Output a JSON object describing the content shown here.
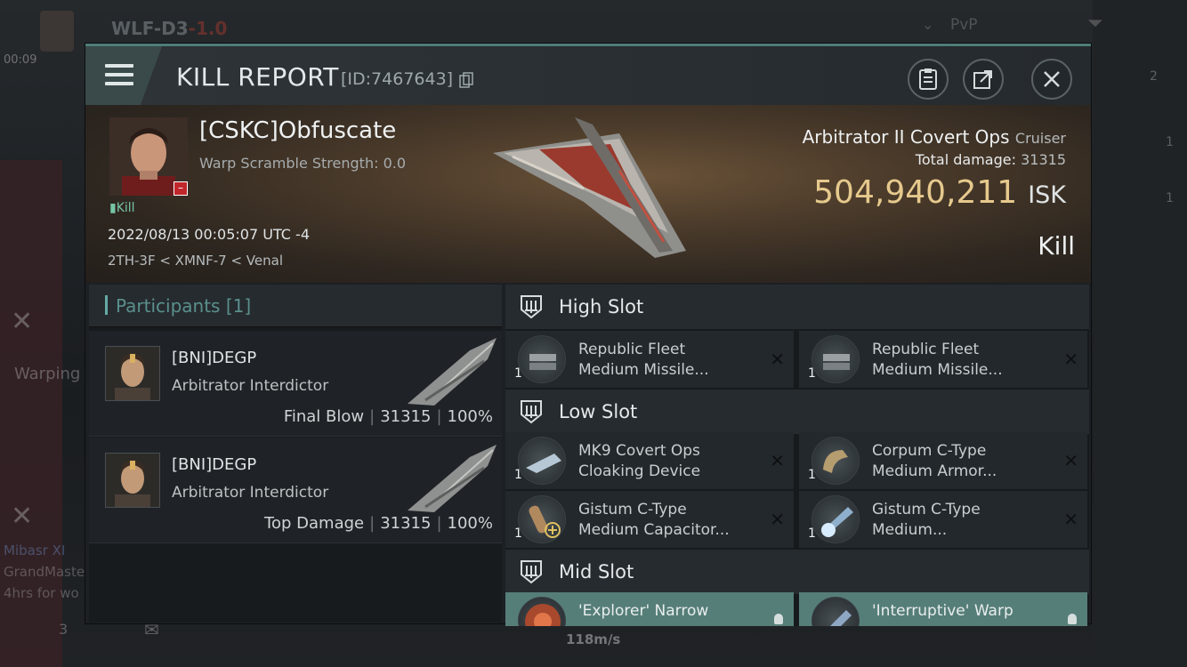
{
  "background": {
    "system_name": "WLF-D3",
    "security": "-1.0",
    "pvp_label": "PvP",
    "timer": "00:09",
    "warping_label": "Warping",
    "chat_name": "Mibasr XI",
    "chat_line": "GrandMaste",
    "chat_time": "4hrs for wo",
    "bottom_count": "3",
    "speed": "118m/s",
    "right_counts": [
      "2",
      "1",
      "1"
    ]
  },
  "header": {
    "title": "KILL REPORT",
    "id_text": "[ID:7467643]"
  },
  "victim": {
    "name": "[CSKC]Obfuscate",
    "warp_scramble": "Warp Scramble Strength: 0.0",
    "kill_tag": "Kill",
    "datetime": "2022/08/13 00:05:07 UTC -4",
    "location": "2TH-3F < XMNF-7 < Venal",
    "ship_name": "Arbitrator II Covert Ops",
    "ship_class": "Cruiser",
    "total_damage_label": "Total damage:",
    "total_damage": "31315",
    "isk_value": "504,940,211",
    "isk_unit": "ISK",
    "result": "Kill"
  },
  "participants": {
    "title": "Participants",
    "count": "[1]",
    "rows": [
      {
        "name": "[BNI]DEGP",
        "ship": "Arbitrator Interdictor",
        "role": "Final Blow",
        "damage": "31315",
        "percent": "100%"
      },
      {
        "name": "[BNI]DEGP",
        "ship": "Arbitrator Interdictor",
        "role": "Top Damage",
        "damage": "31315",
        "percent": "100%"
      }
    ]
  },
  "fitting": {
    "high_slot": {
      "title": "High Slot",
      "modules": [
        {
          "qty": "1",
          "line1": "Republic Fleet",
          "line2": "Medium Missile..."
        },
        {
          "qty": "1",
          "line1": "Republic Fleet",
          "line2": "Medium Missile..."
        }
      ]
    },
    "low_slot": {
      "title": "Low Slot",
      "modules": [
        {
          "qty": "1",
          "line1": "MK9 Covert Ops",
          "line2": "Cloaking Device"
        },
        {
          "qty": "1",
          "line1": "Corpum C-Type",
          "line2": "Medium Armor..."
        },
        {
          "qty": "1",
          "line1": "Gistum C-Type",
          "line2": "Medium Capacitor..."
        },
        {
          "qty": "1",
          "line1": "Gistum C-Type",
          "line2": "Medium..."
        }
      ]
    },
    "mid_slot": {
      "title": "Mid Slot",
      "modules": [
        {
          "qty": "",
          "line1": "'Explorer' Narrow",
          "line2": ""
        },
        {
          "qty": "",
          "line1": "'Interruptive' Warp",
          "line2": ""
        }
      ]
    }
  },
  "colors": {
    "accent": "#4f7d78",
    "isk": "#e6c98d",
    "kill_tag": "#77c4a6",
    "highlight_row": "#567e79"
  }
}
